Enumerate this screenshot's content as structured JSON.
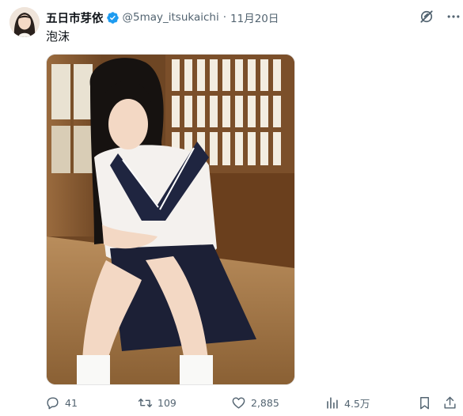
{
  "post": {
    "display_name": "五日市芽依",
    "handle": "@5may_itsukaichi",
    "separator": "·",
    "date": "11月20日",
    "text": "泡沫",
    "verified": true
  },
  "actions": {
    "reply_count": "41",
    "repost_count": "109",
    "like_count": "2,885",
    "view_count": "4.5万"
  },
  "colors": {
    "verified_blue": "#1d9bf0",
    "secondary_text": "#536471",
    "primary_text": "#0f1419"
  },
  "icons": [
    "verified-badge-icon",
    "grok-icon",
    "more-icon",
    "reply-icon",
    "repost-icon",
    "like-icon",
    "views-icon",
    "bookmark-icon",
    "share-icon"
  ]
}
